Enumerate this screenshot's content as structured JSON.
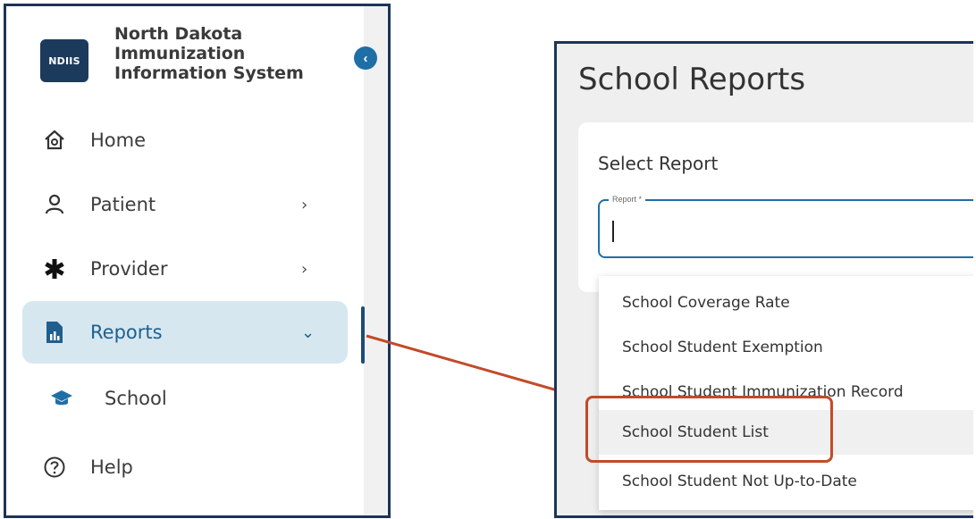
{
  "sidebar": {
    "logo_text": "NDIIS",
    "app_title_lines": [
      "North Dakota",
      "Immunization",
      "Information System"
    ],
    "collapse_icon": "chevron-left-icon",
    "items": [
      {
        "label": "Home",
        "icon": "home-icon"
      },
      {
        "label": "Patient",
        "icon": "person-icon",
        "chevron": "›"
      },
      {
        "label": "Provider",
        "icon": "asterisk-icon",
        "chevron": "›"
      },
      {
        "label": "Reports",
        "icon": "report-icon",
        "chevron": "⌄",
        "active": true
      },
      {
        "label": "School",
        "icon": "graduation-cap-icon"
      },
      {
        "label": "Help",
        "icon": "help-icon"
      }
    ]
  },
  "report_page": {
    "title": "School Reports",
    "card_title": "Select Report",
    "field_label": "Report *",
    "field_value": "",
    "options": [
      "School Coverage Rate",
      "School Student Exemption",
      "School Student Immunization Record",
      "School Student List",
      "School Student Not Up-to-Date"
    ],
    "highlighted_option": "School Student List"
  },
  "colors": {
    "frame": "#1d3457",
    "accent": "#1f6fa6",
    "active_bg": "#d7e7f0",
    "annotation": "#c24a2a"
  }
}
